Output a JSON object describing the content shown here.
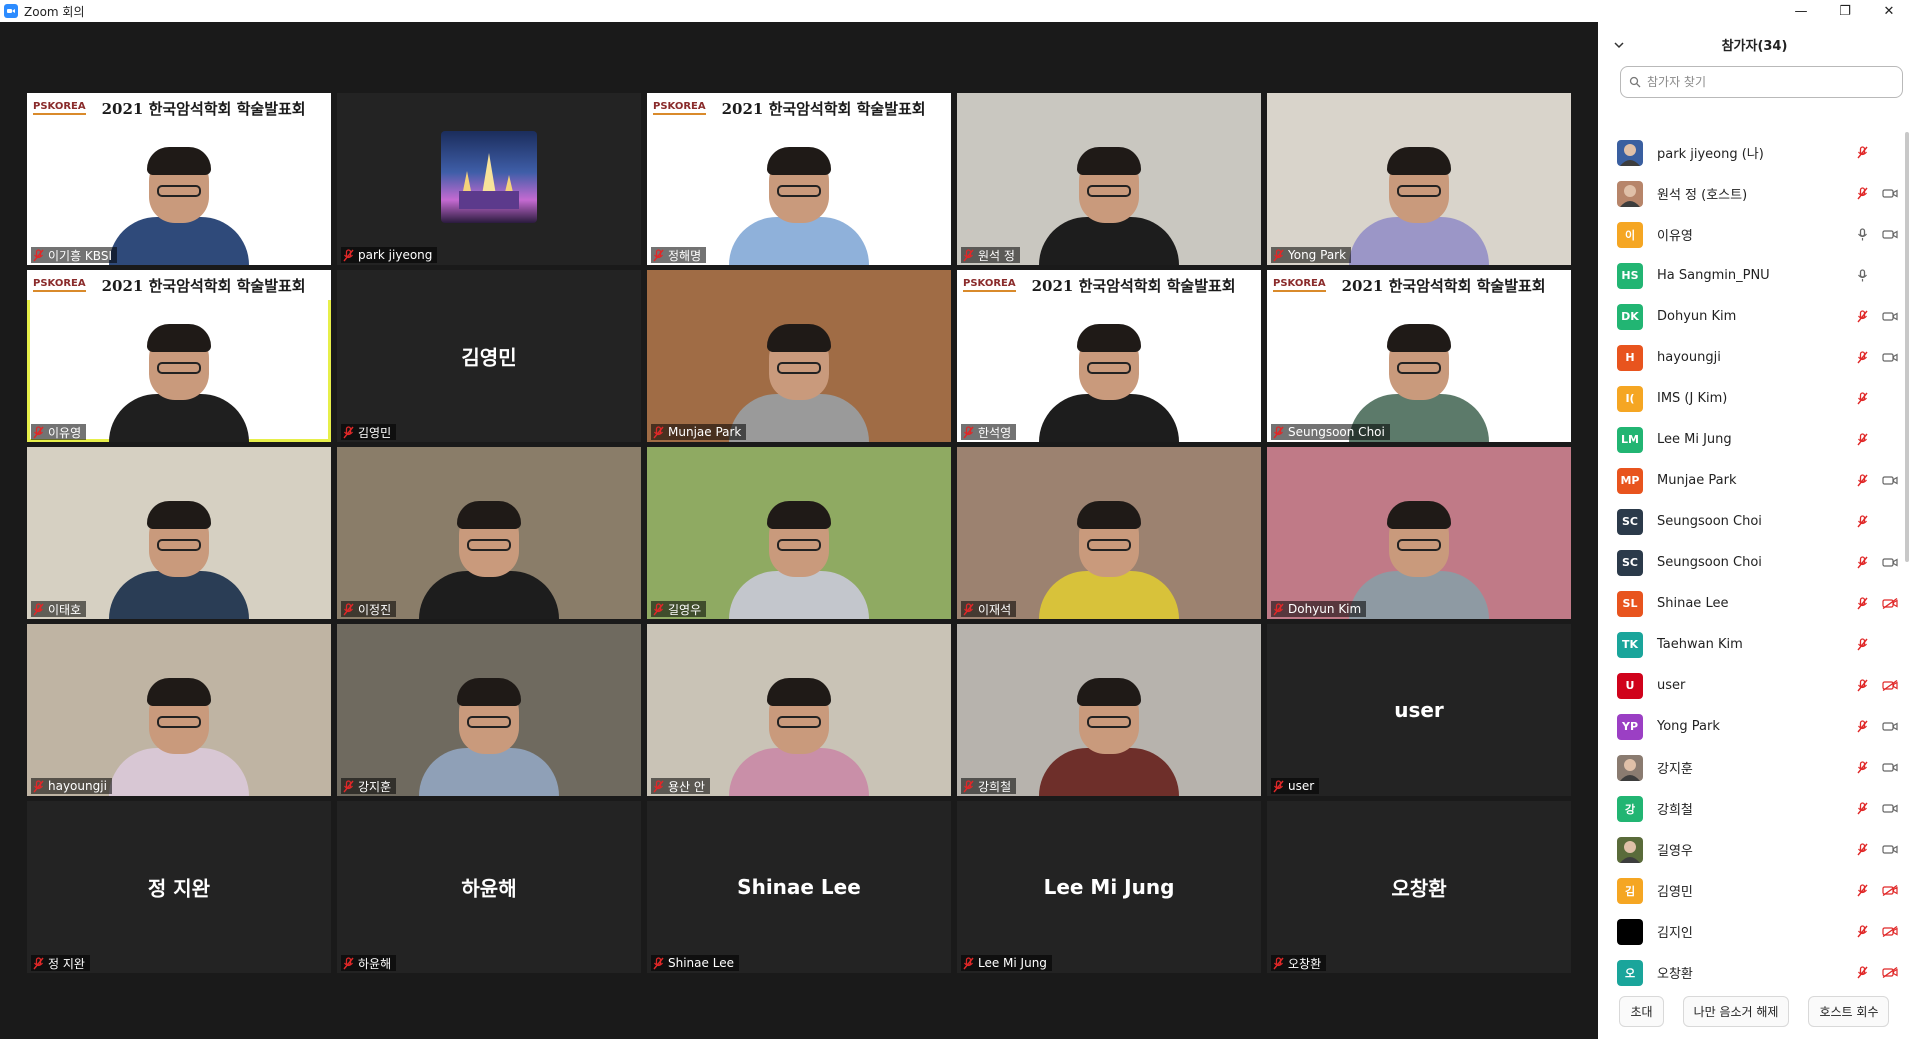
{
  "window": {
    "title": "Zoom 회의"
  },
  "sidebar": {
    "title": "참가자(34)",
    "search_placeholder": "참가자 찾기",
    "footer": {
      "invite": "초대",
      "unmute_me": "나만 음소거 해제",
      "reclaim_host": "호스트 회수"
    },
    "participants": [
      {
        "name": "park jiyeong (나)",
        "initials": "",
        "avatar_color": "#3a5fa0",
        "photo": true,
        "mic": "muted",
        "video": "none"
      },
      {
        "name": "원석 정 (호스트)",
        "initials": "",
        "avatar_color": "#b7856a",
        "photo": true,
        "mic": "muted",
        "video": "on"
      },
      {
        "name": "이유영",
        "initials": "이",
        "avatar_color": "#f5a623",
        "photo": false,
        "mic": "on",
        "video": "on"
      },
      {
        "name": "Ha Sangmin_PNU",
        "initials": "HS",
        "avatar_color": "#22b573",
        "photo": false,
        "mic": "on",
        "video": "none"
      },
      {
        "name": "Dohyun Kim",
        "initials": "DK",
        "avatar_color": "#22b573",
        "photo": false,
        "mic": "muted",
        "video": "on"
      },
      {
        "name": "hayoungji",
        "initials": "H",
        "avatar_color": "#e8541e",
        "photo": false,
        "mic": "muted",
        "video": "on"
      },
      {
        "name": "IMS (J Kim)",
        "initials": "I(",
        "avatar_color": "#f5a623",
        "photo": false,
        "mic": "muted",
        "video": "none"
      },
      {
        "name": "Lee Mi Jung",
        "initials": "LM",
        "avatar_color": "#22b573",
        "photo": false,
        "mic": "muted",
        "video": "none"
      },
      {
        "name": "Munjae Park",
        "initials": "MP",
        "avatar_color": "#e8541e",
        "photo": false,
        "mic": "muted",
        "video": "on"
      },
      {
        "name": "Seungsoon Choi",
        "initials": "SC",
        "avatar_color": "#2b3a4a",
        "photo": false,
        "mic": "muted",
        "video": "none"
      },
      {
        "name": "Seungsoon Choi",
        "initials": "SC",
        "avatar_color": "#2b3a4a",
        "photo": false,
        "mic": "muted",
        "video": "on"
      },
      {
        "name": "Shinae Lee",
        "initials": "SL",
        "avatar_color": "#e8541e",
        "photo": false,
        "mic": "muted",
        "video": "off"
      },
      {
        "name": "Taehwan Kim",
        "initials": "TK",
        "avatar_color": "#1aa59b",
        "photo": false,
        "mic": "muted",
        "video": "none"
      },
      {
        "name": "user",
        "initials": "U",
        "avatar_color": "#d0021b",
        "photo": false,
        "mic": "muted",
        "video": "off"
      },
      {
        "name": "Yong Park",
        "initials": "YP",
        "avatar_color": "#9b3fc4",
        "photo": false,
        "mic": "muted",
        "video": "on"
      },
      {
        "name": "강지훈",
        "initials": "",
        "avatar_color": "#8a7b70",
        "photo": true,
        "mic": "muted",
        "video": "on"
      },
      {
        "name": "강희철",
        "initials": "강",
        "avatar_color": "#22b573",
        "photo": false,
        "mic": "muted",
        "video": "on"
      },
      {
        "name": "길영우",
        "initials": "",
        "avatar_color": "#5a6b3a",
        "photo": true,
        "mic": "muted",
        "video": "on"
      },
      {
        "name": "김영민",
        "initials": "김",
        "avatar_color": "#f5a623",
        "photo": false,
        "mic": "muted",
        "video": "off"
      },
      {
        "name": "김지인",
        "initials": "",
        "avatar_color": "#000000",
        "photo": false,
        "mic": "muted",
        "video": "off"
      },
      {
        "name": "오창환",
        "initials": "오",
        "avatar_color": "#1aa59b",
        "photo": false,
        "mic": "muted",
        "video": "off"
      }
    ]
  },
  "gallery": {
    "slide_logo": "PSKOREA",
    "slide_title": "2021 한국암석학회 학술발표회",
    "tiles": [
      {
        "label": "이기흥 KBSI",
        "kind": "slide",
        "shirt": "#2f4a7a",
        "bg": "#ffffff",
        "active": false,
        "big": ""
      },
      {
        "label": "park jiyeong",
        "kind": "image",
        "shirt": "",
        "bg": "#232323",
        "active": false,
        "big": ""
      },
      {
        "label": "정해명",
        "kind": "slide",
        "shirt": "#8fb1da",
        "bg": "#ffffff",
        "active": false,
        "big": ""
      },
      {
        "label": "원석 정",
        "kind": "cam",
        "shirt": "#1d1d1d",
        "bg": "#c9c7c0",
        "active": false,
        "big": ""
      },
      {
        "label": "Yong Park",
        "kind": "cam",
        "shirt": "#9b96c7",
        "bg": "#d9d4cb",
        "active": false,
        "big": ""
      },
      {
        "label": "이유영",
        "kind": "slide",
        "shirt": "#1f1f1f",
        "bg": "#ffffff",
        "active": true,
        "big": ""
      },
      {
        "label": "김영민",
        "kind": "name",
        "shirt": "",
        "bg": "#232323",
        "active": false,
        "big": "김영민"
      },
      {
        "label": "Munjae Park",
        "kind": "cam",
        "shirt": "#9a9a9a",
        "bg": "#a06c45",
        "active": false,
        "big": ""
      },
      {
        "label": "한석영",
        "kind": "slide",
        "shirt": "#1d1d1d",
        "bg": "#ffffff",
        "active": false,
        "big": ""
      },
      {
        "label": "Seungsoon Choi",
        "kind": "slide",
        "shirt": "#5c7a6a",
        "bg": "#ffffff",
        "active": false,
        "big": ""
      },
      {
        "label": "이태호",
        "kind": "cam",
        "shirt": "#2a3d55",
        "bg": "#d6d0c2",
        "active": false,
        "big": ""
      },
      {
        "label": "이정진",
        "kind": "cam",
        "shirt": "#1d1d1d",
        "bg": "#8a7d69",
        "active": false,
        "big": ""
      },
      {
        "label": "길영우",
        "kind": "cam",
        "shirt": "#c3c6cc",
        "bg": "#8faa62",
        "active": false,
        "big": ""
      },
      {
        "label": "이재석",
        "kind": "cam",
        "shirt": "#d8c23a",
        "bg": "#9c8270",
        "active": false,
        "big": ""
      },
      {
        "label": "Dohyun Kim",
        "kind": "cam",
        "shirt": "#8e9aa3",
        "bg": "#c07a87",
        "active": false,
        "big": ""
      },
      {
        "label": "hayoungji",
        "kind": "cam",
        "shirt": "#d8c7d4",
        "bg": "#bfb4a3",
        "active": false,
        "big": ""
      },
      {
        "label": "강지훈",
        "kind": "cam",
        "shirt": "#8fa0b7",
        "bg": "#6f6a5f",
        "active": false,
        "big": ""
      },
      {
        "label": "용산 안",
        "kind": "cam",
        "shirt": "#c98fa8",
        "bg": "#c9c3b6",
        "active": false,
        "big": ""
      },
      {
        "label": "강희철",
        "kind": "cam",
        "shirt": "#6e2f2a",
        "bg": "#b7b3ad",
        "active": false,
        "big": ""
      },
      {
        "label": "user",
        "kind": "name",
        "shirt": "",
        "bg": "#232323",
        "active": false,
        "big": "user"
      },
      {
        "label": "정 지완",
        "kind": "name",
        "shirt": "",
        "bg": "#232323",
        "active": false,
        "big": "정 지완"
      },
      {
        "label": "하윤해",
        "kind": "name",
        "shirt": "",
        "bg": "#232323",
        "active": false,
        "big": "하윤해"
      },
      {
        "label": "Shinae Lee",
        "kind": "name",
        "shirt": "",
        "bg": "#232323",
        "active": false,
        "big": "Shinae Lee"
      },
      {
        "label": "Lee Mi Jung",
        "kind": "name",
        "shirt": "",
        "bg": "#232323",
        "active": false,
        "big": "Lee Mi Jung"
      },
      {
        "label": "오창환",
        "kind": "name",
        "shirt": "",
        "bg": "#232323",
        "active": false,
        "big": "오창환"
      }
    ]
  }
}
